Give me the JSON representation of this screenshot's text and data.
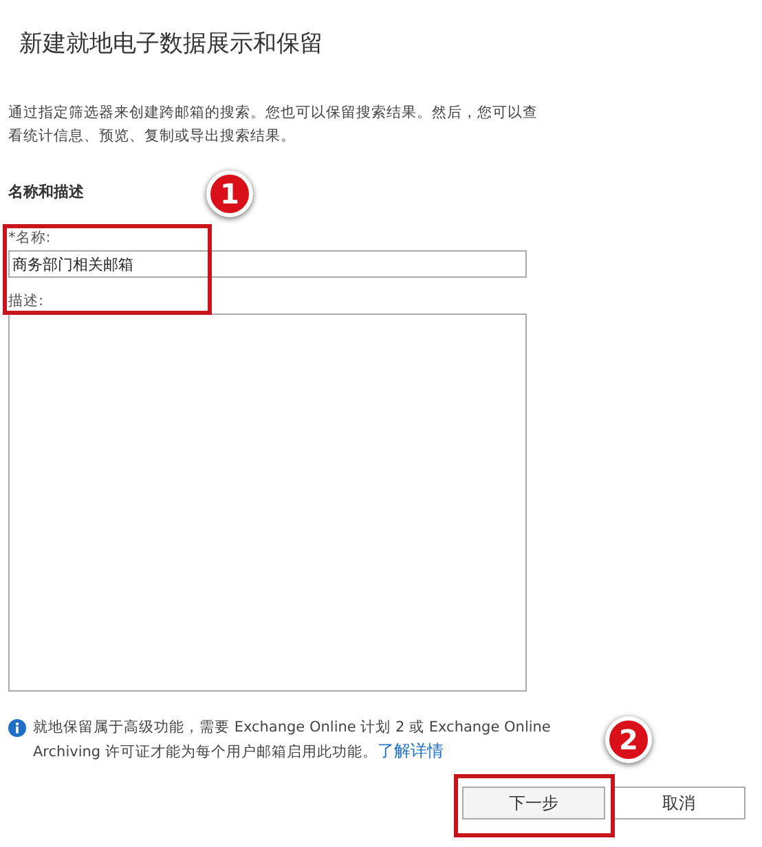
{
  "dialog": {
    "title": "新建就地电子数据展示和保留",
    "intro": "通过指定筛选器来创建跨邮箱的搜索。您也可以保留搜索结果。然后，您可以查看统计信息、预览、复制或导出搜索结果。"
  },
  "section": {
    "heading": "名称和描述"
  },
  "fields": [
    {
      "kind": "input",
      "label": "*名称:",
      "value": "商务部门相关邮箱"
    },
    {
      "kind": "textarea",
      "label": "描述:"
    }
  ],
  "notice": {
    "text": "就地保留属于高级功能，需要 Exchange Online 计划 2 或 Exchange Online Archiving 许可证才能为每个用户邮箱启用此功能。",
    "link": "了解详情"
  },
  "buttons": [
    {
      "label": "下一步",
      "kind": "primary"
    },
    {
      "label": "取消",
      "kind": "secondary"
    }
  ],
  "annotations": [
    {
      "number": "1"
    },
    {
      "number": "2"
    }
  ]
}
